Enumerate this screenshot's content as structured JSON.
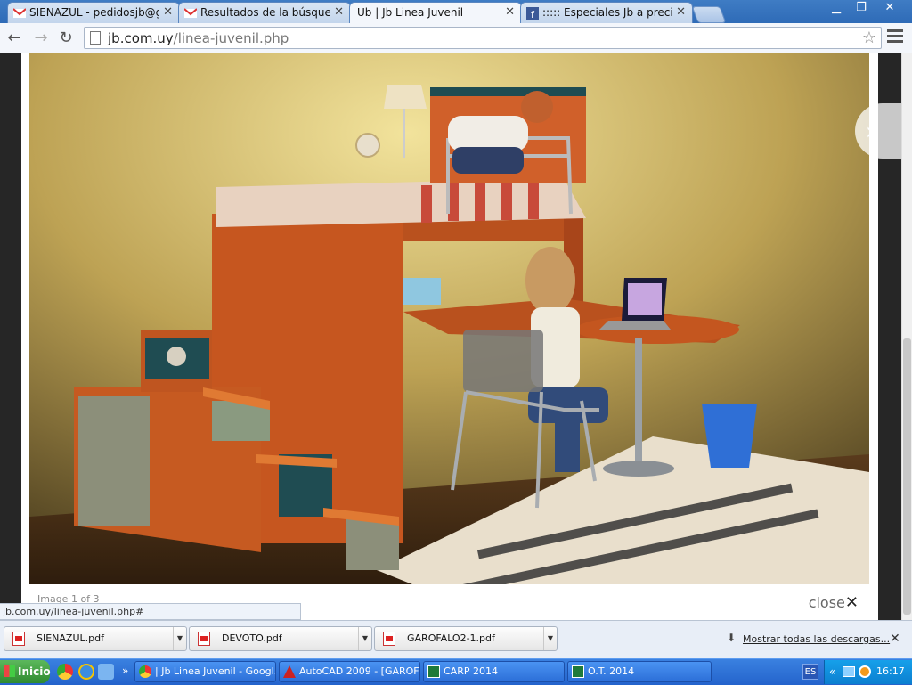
{
  "browser": {
    "tabs": [
      {
        "title": "SIENAZUL - pedidosjb@gmail.",
        "icon": "gmail-icon",
        "active": false
      },
      {
        "title": "Resultados de la búsqueda -",
        "icon": "gmail-icon",
        "active": false
      },
      {
        "title": "ᑌb | Jb Linea Juvenil",
        "icon": "jb-icon",
        "active": true
      },
      {
        "title": "::::: Especiales Jb a precios",
        "icon": "facebook-icon",
        "active": false
      }
    ],
    "url_domain": "jb.com.uy",
    "url_path": "/linea-juvenil.php",
    "status_url": "jb.com.uy/linea-juvenil.php#"
  },
  "lightbox": {
    "caption": "Image 1 of 3",
    "close_label": "close",
    "close_icon": "✕",
    "next_icon": "»"
  },
  "downloads": {
    "items": [
      "SIENAZUL.pdf",
      "DEVOTO.pdf",
      "GAROFALO2-1.pdf"
    ],
    "show_all": "Mostrar todas las descargas...",
    "close_icon": "✕"
  },
  "taskbar": {
    "start_label": "Inicio",
    "chevron": "»",
    "tasks": [
      {
        "label": "| Jb Linea Juvenil - Googl...",
        "icon": "chrome-icon"
      },
      {
        "label": "AutoCAD 2009 - [GAROF...",
        "icon": "autocad-icon"
      },
      {
        "label": "CARP 2014",
        "icon": "excel-icon"
      },
      {
        "label": "O.T. 2014",
        "icon": "excel-icon"
      }
    ],
    "language": "ES",
    "tray_chevron": "«",
    "clock": "16:17"
  },
  "colors": {
    "tabstrip": "#2e6bb7",
    "taskbar": "#2463cc",
    "tray": "#0c7fd0",
    "page_backdrop": "#262626"
  }
}
